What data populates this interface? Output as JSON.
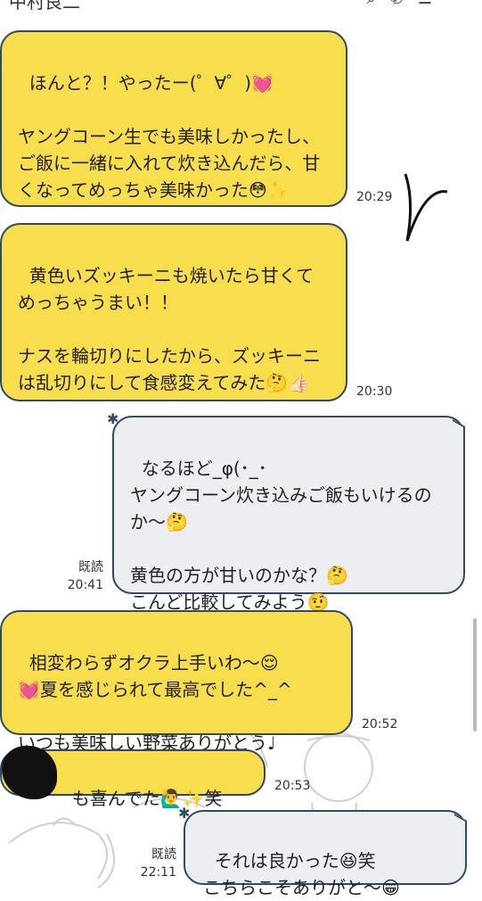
{
  "header": {
    "title": "中村良二",
    "icons": [
      "search-icon",
      "phone-icon",
      "menu-icon"
    ]
  },
  "messages": [
    {
      "side": "received",
      "text": "ほんと？！やったー(゜∀゜)💓\n\nヤングコーン生でも美味しかったし、ご飯に一緒に入れて炊き込んだら、甘くなってめっちゃ美味かった😳✨",
      "time": "20:29"
    },
    {
      "side": "received",
      "text": "黄色いズッキーニも焼いたら甘くてめっちゃうまい！！\n\nナスを輪切りにしたから、ズッキーニは乱切りにして食感変えてみた🤔👍🏻",
      "time": "20:30"
    },
    {
      "side": "sent",
      "text": "なるほど_φ(･_･\nヤングコーン炊き込みご飯もいけるのか〜🤔\n\n黄色の方が甘いのかな？🤔\nこんど比較してみよう🤨",
      "read": "既読",
      "time": "20:41"
    },
    {
      "side": "received",
      "text": "相変わらずオクラ上手いわ〜😌\n💓夏を感じられて最高でした^_^\n\nいつも美味しい野菜ありがとう♩",
      "time": "20:52"
    },
    {
      "side": "received",
      "text": "も喜んでた🙋‍♂️✨笑",
      "time": "20:53"
    },
    {
      "side": "sent",
      "text": "それは良かった😆笑\nこちらこそありがと〜😁",
      "read": "既読",
      "time": "22:11"
    }
  ],
  "colors": {
    "received_bubble": "#f8dd4d",
    "sent_bubble": "#edeef2",
    "bubble_border": "#2f4a63"
  }
}
